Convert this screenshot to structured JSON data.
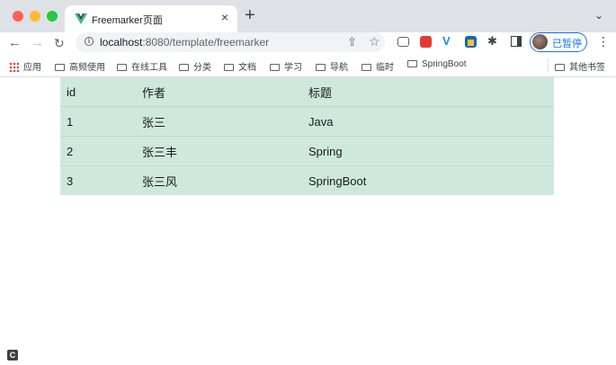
{
  "browser": {
    "tab": {
      "title": "Freemarker页面",
      "favicon": "vue-logo-icon"
    },
    "url": {
      "host": "localhost",
      "rest": ":8080/template/freemarker"
    },
    "profile_label": "已暂停",
    "bookmarks": [
      "应用",
      "高频使用",
      "在线工具",
      "分类",
      "文档",
      "学习",
      "导航",
      "临时",
      "SpringBoot"
    ],
    "other_bookmarks": "其他书签"
  },
  "table": {
    "headers": [
      "id",
      "作者",
      "标题"
    ],
    "rows": [
      [
        "1",
        "张三",
        "Java"
      ],
      [
        "2",
        "张三丰",
        "Spring"
      ],
      [
        "3",
        "张三风",
        "SpringBoot"
      ]
    ]
  },
  "colors": {
    "table_bg": "#cfe8de",
    "tabstrip_bg": "#dee1e6",
    "profile_accent": "#1a73e8"
  }
}
